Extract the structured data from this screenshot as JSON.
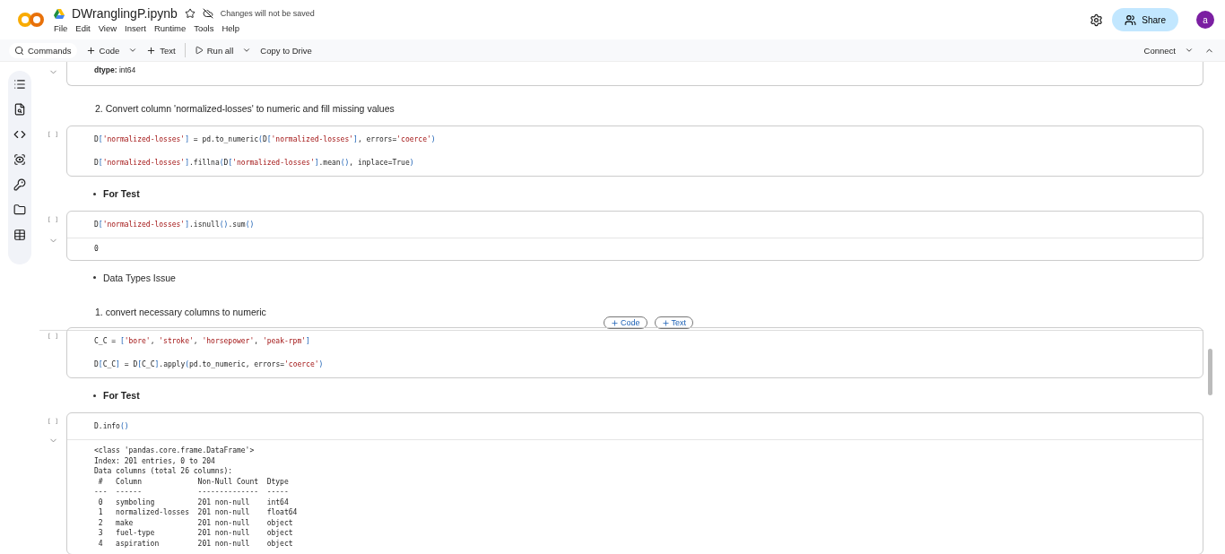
{
  "header": {
    "title": "DWranglingP.ipynb",
    "starred": false,
    "save_status": "Changes will not be saved",
    "menu": [
      "File",
      "Edit",
      "View",
      "Insert",
      "Runtime",
      "Tools",
      "Help"
    ],
    "share": "Share",
    "avatar": "a"
  },
  "toolbar": {
    "commands": "Commands",
    "add_code": "Code",
    "add_text": "Text",
    "run_all": "Run all",
    "copy": "Copy to Drive",
    "connect": "Connect"
  },
  "cells": [
    {
      "kind": "output_tail",
      "label": "dtype:",
      "value": "int64"
    },
    {
      "kind": "text",
      "text": "2. Convert column 'normalized-losses' to numeric and fill missing values"
    },
    {
      "kind": "code",
      "run_mark": "[ ]",
      "statements": [
        "D['normalized-losses'] = pd.to_numeric(D['normalized-losses'], errors='coerce')",
        "D['normalized-losses'].fillna(D['normalized-losses'].mean(), inplace=True)"
      ]
    },
    {
      "kind": "heading_bullet",
      "text": "For Test"
    },
    {
      "kind": "code",
      "run_mark": "[ ]",
      "statements": [
        "D['normalized-losses'].isnull().sum()"
      ],
      "output": [
        "0"
      ]
    },
    {
      "kind": "bullet",
      "text": "Data Types Issue"
    },
    {
      "kind": "text",
      "text": "1. convert necessary columns to numeric"
    },
    {
      "kind": "inserter",
      "buttons": [
        "Code",
        "Text"
      ]
    },
    {
      "kind": "code",
      "run_mark": "[ ]",
      "statements": [
        "C_C = ['bore', 'stroke', 'horsepower', 'peak-rpm']",
        "D[C_C] = D[C_C].apply(pd.to_numeric, errors='coerce')"
      ]
    },
    {
      "kind": "heading_bullet",
      "text": "For Test"
    },
    {
      "kind": "code",
      "run_mark": "[ ]",
      "statements": [
        "D.info()"
      ],
      "output": [
        "<class 'pandas.core.frame.DataFrame'>",
        "Index: 201 entries, 0 to 204",
        "Data columns (total 26 columns):",
        " #   Column             Non-Null Count  Dtype  ",
        "---  ------             --------------  -----  ",
        " 0   symboling          201 non-null    int64  ",
        " 1   normalized-losses  201 non-null    float64",
        " 2   make               201 non-null    object ",
        " 3   fuel-type          201 non-null    object ",
        " 4   aspiration         201 non-null    object "
      ]
    }
  ]
}
